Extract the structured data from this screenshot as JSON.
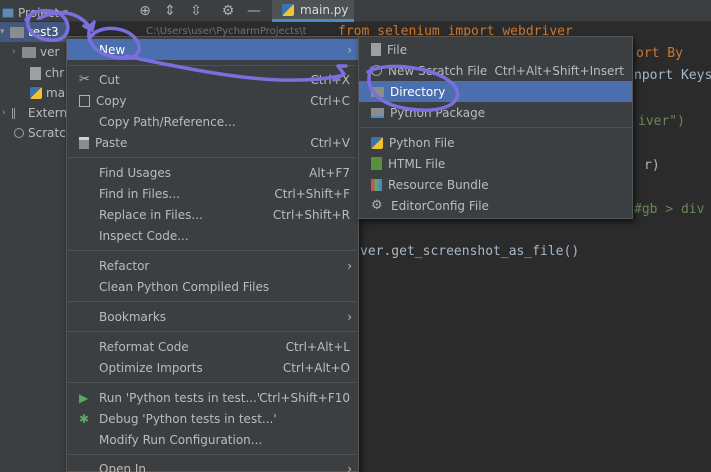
{
  "toolbar": {
    "project_label": "Project",
    "active_tab": "main.py"
  },
  "tree": {
    "root": "test3",
    "items": [
      "ver",
      "chr",
      "ma",
      "Externa",
      "Scratch"
    ],
    "breadcrumb_fragment": "C:\\Users\\user\\PycharmProjects\\t"
  },
  "editor": {
    "lines": [
      "from selenium import webdriver",
      "ort By",
      "nport Keys",
      "iver\")",
      "r)",
      "#gb > div",
      "ver.get_screenshot_as_file()"
    ]
  },
  "context_menu": {
    "items": [
      {
        "label": "New",
        "shortcut": "",
        "submenu": true,
        "selected": true
      },
      {
        "label": "Cut",
        "shortcut": "Ctrl+X",
        "icon": "scissors-icon"
      },
      {
        "label": "Copy",
        "shortcut": "Ctrl+C",
        "icon": "copy-icon"
      },
      {
        "label": "Copy Path/Reference...",
        "shortcut": ""
      },
      {
        "label": "Paste",
        "shortcut": "Ctrl+V",
        "icon": "paste-icon"
      },
      {
        "label": "Find Usages",
        "shortcut": "Alt+F7"
      },
      {
        "label": "Find in Files...",
        "shortcut": "Ctrl+Shift+F"
      },
      {
        "label": "Replace in Files...",
        "shortcut": "Ctrl+Shift+R"
      },
      {
        "label": "Inspect Code...",
        "shortcut": ""
      },
      {
        "label": "Refactor",
        "shortcut": "",
        "submenu": true
      },
      {
        "label": "Clean Python Compiled Files",
        "shortcut": ""
      },
      {
        "label": "Bookmarks",
        "shortcut": "",
        "submenu": true
      },
      {
        "label": "Reformat Code",
        "shortcut": "Ctrl+Alt+L"
      },
      {
        "label": "Optimize Imports",
        "shortcut": "Ctrl+Alt+O"
      },
      {
        "label": "Run 'Python tests in test...'",
        "shortcut": "Ctrl+Shift+F10",
        "icon": "run-icon"
      },
      {
        "label": "Debug 'Python tests in test...'",
        "shortcut": "",
        "icon": "debug-icon"
      },
      {
        "label": "Modify Run Configuration...",
        "shortcut": ""
      },
      {
        "label": "Open In",
        "shortcut": "",
        "submenu": true
      }
    ]
  },
  "submenu": {
    "items": [
      {
        "label": "File",
        "shortcut": "",
        "icon": "file-icon"
      },
      {
        "label": "New Scratch File",
        "shortcut": "Ctrl+Alt+Shift+Insert",
        "icon": "scratch-icon"
      },
      {
        "label": "Directory",
        "shortcut": "",
        "icon": "folder-icon",
        "selected": true
      },
      {
        "label": "Python Package",
        "shortcut": "",
        "icon": "package-icon"
      },
      {
        "label": "Python File",
        "shortcut": "",
        "icon": "python-file-icon"
      },
      {
        "label": "HTML File",
        "shortcut": "",
        "icon": "html-file-icon"
      },
      {
        "label": "Resource Bundle",
        "shortcut": "",
        "icon": "resource-bundle-icon"
      },
      {
        "label": "EditorConfig File",
        "shortcut": "",
        "icon": "gear-icon"
      }
    ]
  },
  "colors": {
    "selection": "#4b6eaf",
    "annotation": "#6a5acd"
  }
}
